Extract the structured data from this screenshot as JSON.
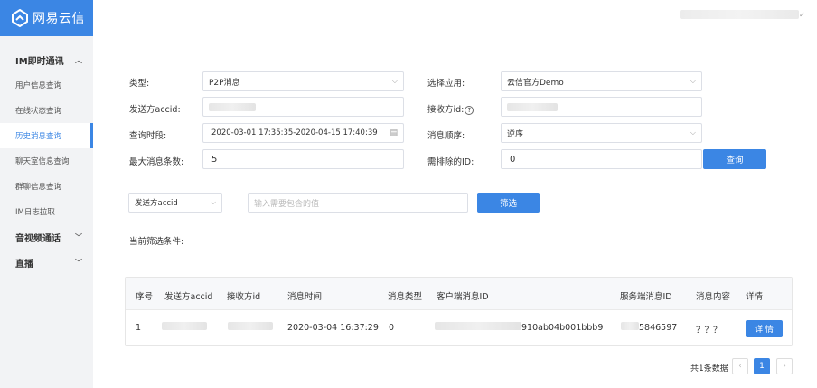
{
  "sidebar": {
    "logo_text": "网易云信",
    "groups": [
      {
        "label": "IM即时通讯",
        "chevron": "chevron-up-icon",
        "items": [
          {
            "label": "用户信息查询"
          },
          {
            "label": "在线状态查询"
          },
          {
            "label": "历史消息查询",
            "active": true
          },
          {
            "label": "聊天室信息查询"
          },
          {
            "label": "群聊信息查询"
          },
          {
            "label": "IM日志拉取"
          }
        ]
      },
      {
        "label": "音视频通话",
        "chevron": "chevron-down-icon"
      },
      {
        "label": "直播",
        "chevron": "chevron-down-icon"
      }
    ]
  },
  "form": {
    "type_label": "类型:",
    "type_value": "P2P消息",
    "sender_label": "发送方accid:",
    "time_label": "查询时段:",
    "time_start": "2020-03-01 17:35:35",
    "time_sep": "-",
    "time_end": "2020-04-15 17:40:39",
    "max_label": "最大消息条数:",
    "max_value": "5",
    "app_label": "选择应用:",
    "app_value": "云信官方Demo",
    "receiver_label": "接收方id:",
    "order_label": "消息顺序:",
    "order_value": "逆序",
    "exclude_label": "需排除的ID:",
    "exclude_value": "0",
    "query_button": "查询"
  },
  "filter": {
    "field_value": "发送方accid",
    "input_placeholder": "输入需要包含的值",
    "filter_button": "筛选",
    "current_label": "当前筛选条件:"
  },
  "table": {
    "headers": [
      "序号",
      "发送方accid",
      "接收方id",
      "消息时间",
      "消息类型",
      "客户端消息ID",
      "服务端消息ID",
      "消息内容",
      "详情"
    ],
    "rows": [
      {
        "index": "1",
        "time": "2020-03-04 16:37:29",
        "type": "0",
        "client_id_tail": "910ab04b001bbb9",
        "server_id_tail": "5846597",
        "content": "？？？",
        "detail_button": "详 情"
      }
    ]
  },
  "pagination": {
    "total": "共1条数据",
    "current_page": "1"
  },
  "colors": {
    "accent": "#3b86e4",
    "sidebar_bg": "#f2f3f5"
  }
}
